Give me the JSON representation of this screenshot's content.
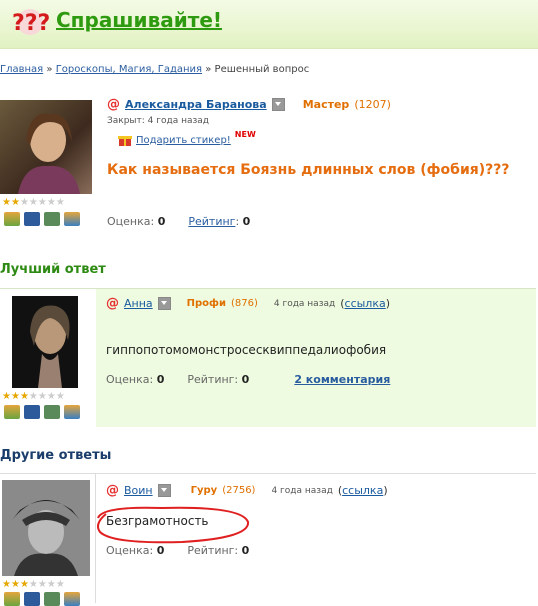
{
  "header": {
    "title": "Спрашивайте!",
    "logo_icon": "question-marks-icon"
  },
  "breadcrumb": {
    "home": "Главная",
    "sep1": "»",
    "category": "Гороскопы, Магия, Гадания",
    "sep2": "»",
    "current": "Решенный вопрос"
  },
  "question": {
    "at": "@",
    "author": "Александра Баранова",
    "rank": "Мастер",
    "points": "(1207)",
    "closed": "Закрыт: 4 года назад",
    "gift_label": "Подарить стикер!",
    "new_badge": "NEW",
    "title": "Как называется Боязнь длинных слов (фобия)???",
    "score_label": "Оценка:",
    "score_value": "0",
    "rating_label": "Рейтинг",
    "rating_colon": ":",
    "rating_value": "0",
    "stars_filled": 2,
    "stars_total": 7
  },
  "best_answer": {
    "heading": "Лучший ответ",
    "at": "@",
    "author": "Анна",
    "rank": "Профи",
    "points": "(876)",
    "time": "4 года назад",
    "link": "ссылка",
    "text": "гиппопотомомонстросесквиппедалиофобия",
    "score_label": "Оценка:",
    "score_value": "0",
    "rating_label": "Рейтинг:",
    "rating_value": "0",
    "comments": "2 комментария",
    "stars_filled": 3,
    "stars_total": 7
  },
  "other_answers": {
    "heading": "Другие ответы",
    "items": [
      {
        "at": "@",
        "author": "Воин",
        "rank": "Гуру",
        "points": "(2756)",
        "time": "4 года назад",
        "link": "ссылка",
        "text": "Безграмотность",
        "score_label": "Оценка:",
        "score_value": "0",
        "rating_label": "Рейтинг:",
        "rating_value": "0",
        "stars_filled": 3,
        "stars_total": 7
      }
    ]
  },
  "colors": {
    "accent_green": "#2e9a10",
    "rank_orange": "#e07000",
    "title_orange": "#e56d10",
    "best_bg": "#eefbe0",
    "annotation_red": "#e02020"
  }
}
